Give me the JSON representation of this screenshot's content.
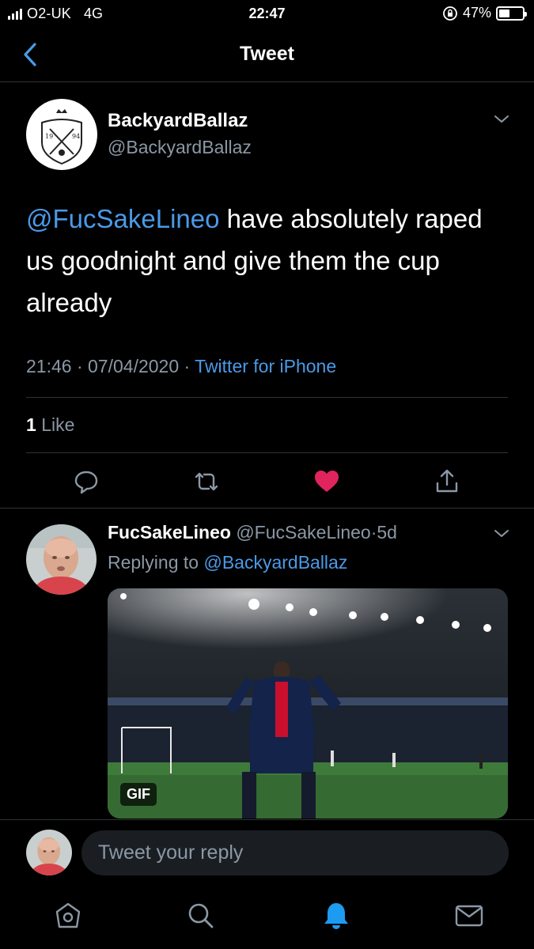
{
  "status_bar": {
    "carrier": "O2-UK",
    "network": "4G",
    "time": "22:47",
    "battery": "47%",
    "battery_level": 0.47
  },
  "nav": {
    "title": "Tweet",
    "back_icon": "chevron-left-icon"
  },
  "tweet": {
    "author_name": "BackyardBallaz",
    "author_handle": "@BackyardBallaz",
    "avatar_icon": "team-crest-logo",
    "mention": "@FucSakeLineo",
    "text": " have absolutely raped us goodnight and give them the cup already",
    "time": "21:46",
    "date": "07/04/2020",
    "source": "Twitter for iPhone",
    "like_count": "1",
    "like_label": "Like",
    "liked": true,
    "like_color": "#e0245e",
    "actions": [
      "reply-icon",
      "retweet-icon",
      "like-icon",
      "share-icon"
    ]
  },
  "reply": {
    "author_name": "FucSakeLineo",
    "author_handle": "@FucSakeLineo",
    "separator": "·",
    "age": "5d",
    "replying_prefix": "Replying to ",
    "replying_to": "@BackyardBallaz",
    "media_badge": "GIF"
  },
  "composer": {
    "placeholder": "Tweet your reply"
  },
  "tabbar": {
    "tabs": [
      "home-icon",
      "search-icon",
      "notifications-icon",
      "messages-icon"
    ],
    "active_tab": "notifications-icon"
  },
  "colors": {
    "accent": "#4a9ae8",
    "muted": "#8b98a5",
    "background": "#000000",
    "divider": "#2f3336",
    "like": "#e0245e"
  }
}
